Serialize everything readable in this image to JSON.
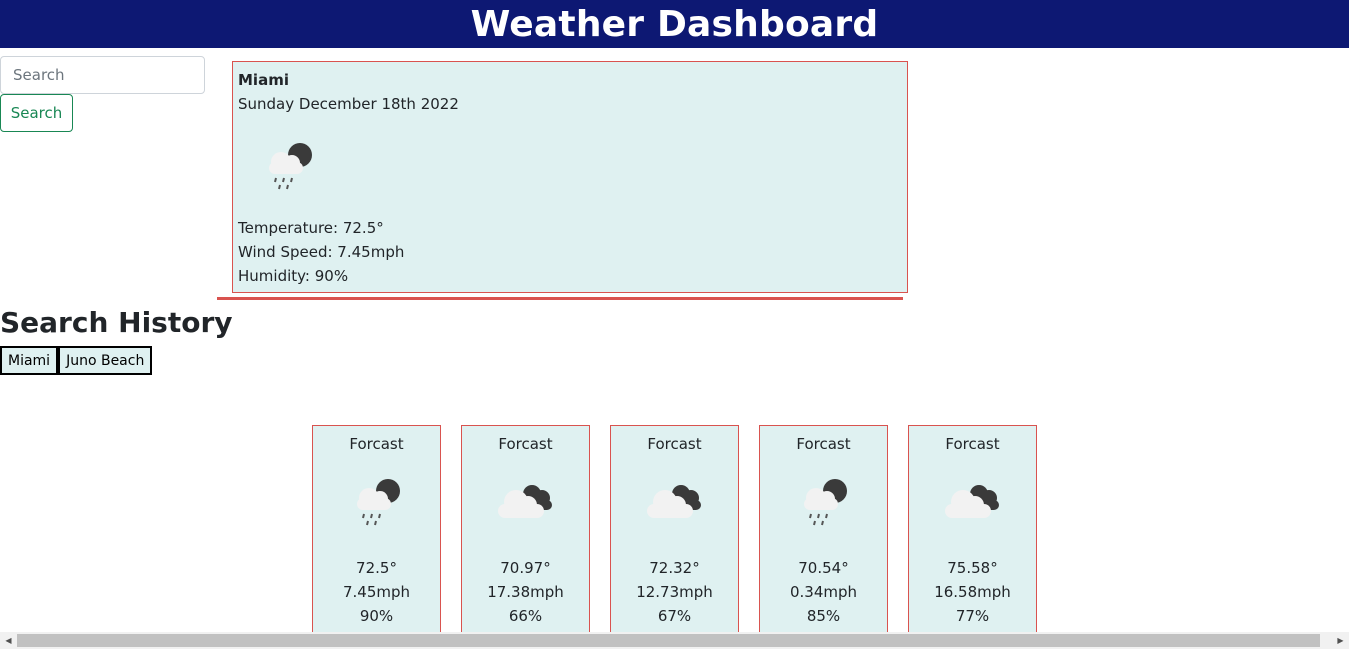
{
  "header": {
    "title": "Weather Dashboard"
  },
  "search": {
    "placeholder": "Search",
    "value": "",
    "button_label": "Search"
  },
  "current": {
    "city": "Miami",
    "date": "Sunday December 18th 2022",
    "icon": "rain-cloud-night-icon",
    "temperature": "Temperature: 72.5°",
    "wind": "Wind Speed: 7.45mph",
    "humidity": "Humidity: 90%"
  },
  "history": {
    "title": "Search History",
    "items": [
      "Miami",
      "Juno Beach"
    ]
  },
  "forecast": [
    {
      "title": "Forcast",
      "icon": "rain-cloud-night-icon",
      "temp": "72.5°",
      "wind": "7.45mph",
      "humidity": "90%"
    },
    {
      "title": "Forcast",
      "icon": "cloudy-night-icon",
      "temp": "70.97°",
      "wind": "17.38mph",
      "humidity": "66%"
    },
    {
      "title": "Forcast",
      "icon": "cloudy-night-icon",
      "temp": "72.32°",
      "wind": "12.73mph",
      "humidity": "67%"
    },
    {
      "title": "Forcast",
      "icon": "rain-cloud-night-icon",
      "temp": "70.54°",
      "wind": "0.34mph",
      "humidity": "85%"
    },
    {
      "title": "Forcast",
      "icon": "cloudy-night-icon",
      "temp": "75.58°",
      "wind": "16.58mph",
      "humidity": "77%"
    }
  ],
  "colors": {
    "header_bg": "#0d1873",
    "card_bg": "#dff1f1",
    "card_border": "#d9534f",
    "search_button": "#198754"
  }
}
